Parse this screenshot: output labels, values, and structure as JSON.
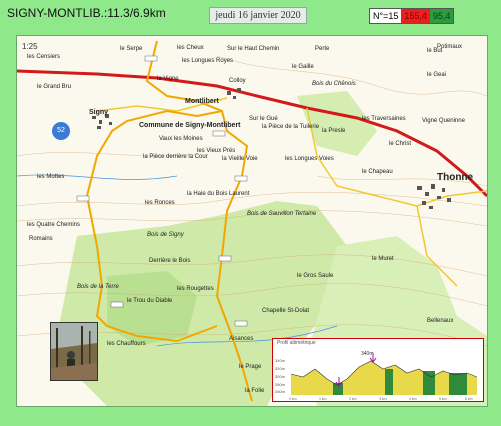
{
  "header": {
    "title": "SIGNY-MONTLIB.:11.3/6.9km",
    "date": "jeudi 16 janvier 2020",
    "stat_n": "N°=15",
    "stat_red": "155,4",
    "stat_green": "95,4"
  },
  "map": {
    "badge": "52",
    "compass": "1:25",
    "labels": {
      "serpe": "le Serpe",
      "cheux": "les Cheux",
      "longues_royes": "les Longues Royes",
      "vigne": "la Vigne",
      "sur_haut_chemin": "Sur le Haut Chemin",
      "censiers": "les Censiers",
      "grand_bru": "le Grand Bru",
      "signy": "Signy",
      "colloy": "Colloy",
      "montlibert": "Montlibert",
      "commune": "Commune de Signy-Montlibert",
      "gaille": "le Gaille",
      "bois_chenois": "Bois du Chênois",
      "sur_le_gue": "Sur le Gué",
      "piece_tuilerie": "la Pièce de la Tuilerie",
      "presle": "la Presle",
      "traversaines": "les Traversaines",
      "vigne_queninne": "Vigne Queninne",
      "potimaux": "Potimaux",
      "le_but": "le But",
      "le_geai": "le Geai",
      "le_christ": "le Christ",
      "le_chapeau": "le Chapeau",
      "thonne": "Thonne",
      "vaux_moines": "Vaux les Moines",
      "piece_derriere": "la Pièce derrière la Cour",
      "vieux_pres": "les Vieux Prés",
      "vieille_voie": "la Vieille Voie",
      "longues_voies": "les Longues Voies",
      "les_mottes": "les Mottes",
      "quatre_chemins": "les Quatre Chemins",
      "romains": "Romains",
      "les_ronces": "les Ronces",
      "haie_bois": "la Haie du Bois Laurent",
      "bois_signy": "Bois de Signy",
      "bois_sauvillon": "Bois de Sauvillon Tertaine",
      "derriere_bois": "Derrière le Bois",
      "rougettes": "les Rougettes",
      "trou_diable": "le Trou du Diable",
      "bois_terre": "Bois de la Terre",
      "gros_saule": "le Gros Saule",
      "le_muret": "le Muret",
      "chapelle": "Chapelle St-Dolat",
      "aisances": "Aisances",
      "le_prage": "le Prage",
      "la_folie": "la Folie",
      "bellenaux": "Bellenaux",
      "la_chauffours": "les Chauffours",
      "perte": "Perte"
    }
  },
  "profile": {
    "title": "Profil altimétrique",
    "peak_label": "340m",
    "y_ticks": [
      "340m",
      "320m",
      "300m",
      "280m",
      "260m"
    ],
    "x_ticks": [
      "0 km",
      "1 km",
      "2 km",
      "3 km",
      "4 km",
      "5 km",
      "6 km"
    ]
  }
}
